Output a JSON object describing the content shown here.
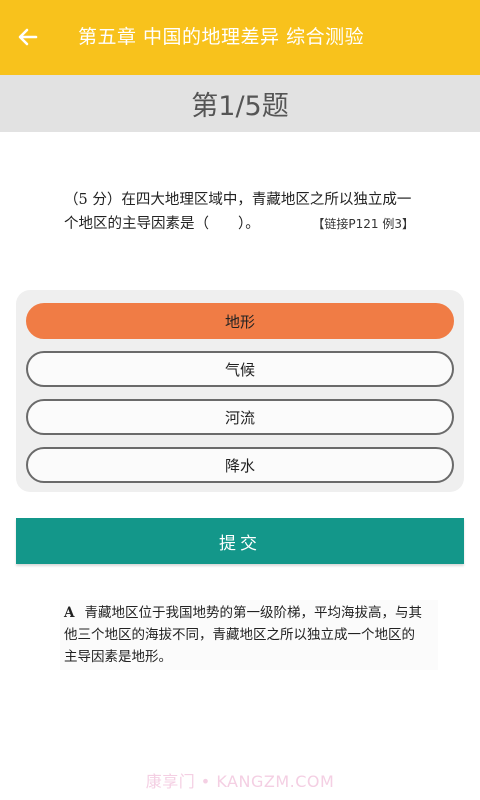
{
  "header": {
    "title": "第五章 中国的地理差异  综合测验",
    "back_icon": "arrow-left-icon"
  },
  "question_bar": {
    "label": "第1/5题"
  },
  "question": {
    "line1": "（5 分）在四大地理区域中，青藏地区之所以独立成一",
    "line2": "个地区的主导因素是（　　）。",
    "reference": "【链接P121 例3】"
  },
  "options": [
    {
      "label": "地形",
      "selected": true
    },
    {
      "label": "气候",
      "selected": false
    },
    {
      "label": "河流",
      "selected": false
    },
    {
      "label": "降水",
      "selected": false
    }
  ],
  "submit": {
    "label": "提交"
  },
  "answer": {
    "letter": "A",
    "line1": "青藏地区位于我国地势的第一级阶梯，平均海拔高，与其",
    "line2": "他三个地区的海拔不同，青藏地区之所以独立成一个地区的",
    "line3": "主导因素是地形。"
  },
  "watermark": "康享门 • KANGZM.COM",
  "colors": {
    "header": "#F8C21C",
    "question_bar": "#E2E2E2",
    "selected_option": "#F07C45",
    "submit": "#13978A"
  }
}
